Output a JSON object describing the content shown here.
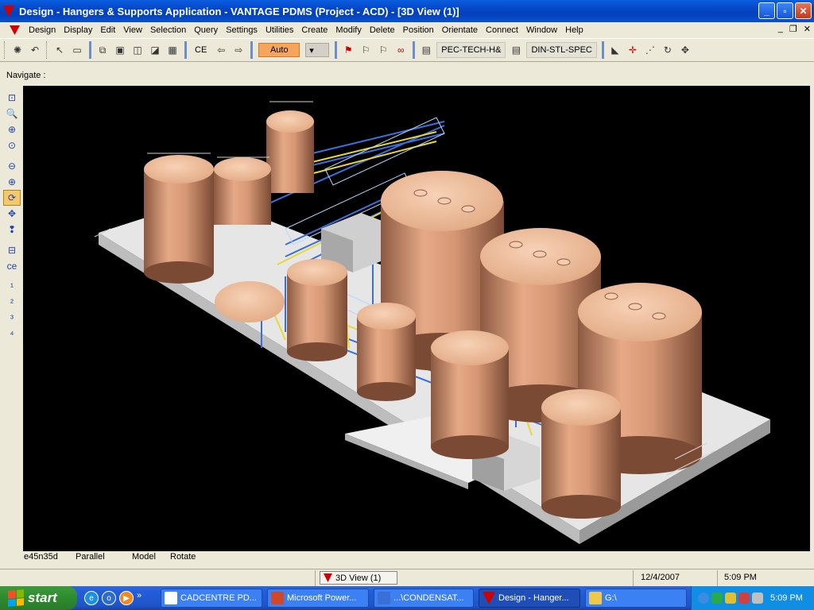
{
  "window": {
    "title": "Design - Hangers & Supports Application - VANTAGE PDMS (Project - ACD) - [3D View (1)]"
  },
  "menu": [
    "Design",
    "Display",
    "Edit",
    "View",
    "Selection",
    "Query",
    "Settings",
    "Utilities",
    "Create",
    "Modify",
    "Delete",
    "Position",
    "Orientate",
    "Connect",
    "Window",
    "Help"
  ],
  "toolbar": {
    "ce_label": "CE",
    "auto_label": "Auto",
    "spec1": "PEC-TECH-H&",
    "spec2": "DIN-STL-SPEC"
  },
  "navigate_label": "Navigate :",
  "status": {
    "view_dir": "e45n35d",
    "projection": "Parallel",
    "mode": "Model",
    "action": "Rotate"
  },
  "bottom": {
    "view_tab": "3D View (1)",
    "date": "12/4/2007",
    "time": "5:09 PM"
  },
  "taskbar": {
    "start": "start",
    "tasks": [
      "CADCENTRE PD...",
      "Microsoft Power...",
      "...\\CONDENSAT...",
      "Design - Hanger...",
      "G:\\"
    ],
    "clock": "5:09 PM"
  },
  "colors": {
    "tank": "#d99a78",
    "platform": "#e8e8e8",
    "pipe_blue": "#3a6fd8",
    "pipe_yellow": "#e8d830",
    "viewport_bg": "#000000"
  }
}
